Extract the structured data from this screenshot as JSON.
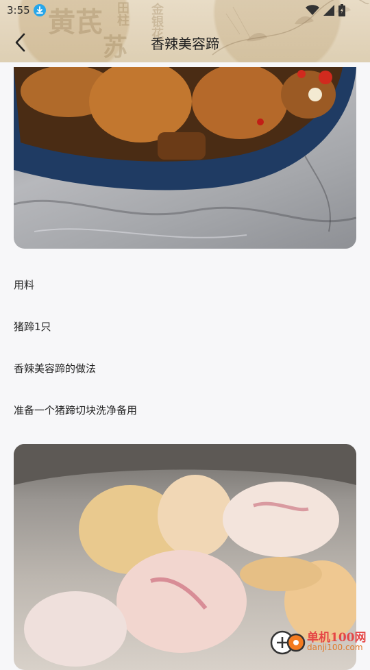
{
  "status_bar": {
    "time": "3:55",
    "download_icon": "download-icon",
    "wifi_icon": "wifi-icon",
    "signal_icon": "signal-icon",
    "battery_icon": "battery-icon"
  },
  "header": {
    "title": "香辣美容蹄",
    "back_icon": "chevron-left-icon",
    "background_text": [
      "黄芪",
      "苏",
      "金银花",
      "田柱"
    ]
  },
  "content": {
    "ingredients_heading": "用料",
    "ingredient_line": "猪蹄1只",
    "method_heading": "香辣美容蹄的做法",
    "step_1": "准备一个猪蹄切块洗净备用"
  },
  "watermark": {
    "name": "单机100网",
    "url": "danji100.com"
  },
  "colors": {
    "accent_download": "#27a6ea",
    "watermark_red": "#e54646",
    "watermark_orange": "#e07a2a",
    "page_bg": "#f7f7f9"
  }
}
